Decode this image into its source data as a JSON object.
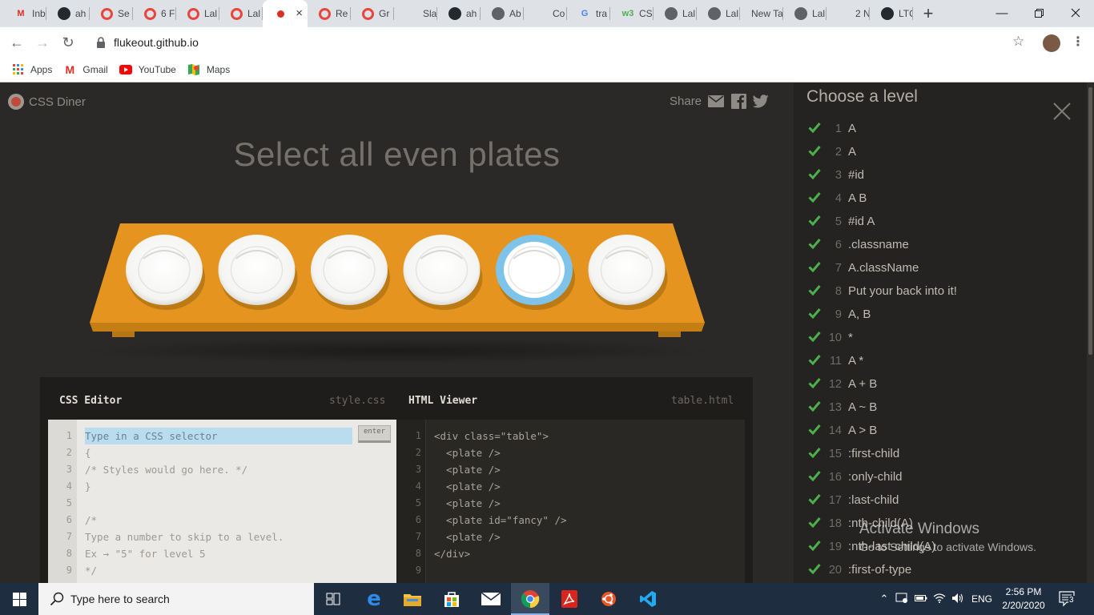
{
  "browser": {
    "tabs": [
      {
        "label": "Inb",
        "icon": "gmail-icon",
        "color": "#d93025",
        "glyph": "M"
      },
      {
        "label": "ah",
        "icon": "github-icon",
        "color": "#24292e",
        "glyph": ""
      },
      {
        "label": "Se",
        "icon": "shield-icon",
        "color": "#e8453c",
        "glyph": ""
      },
      {
        "label": "6 F",
        "icon": "shield-icon",
        "color": "#e8453c",
        "glyph": ""
      },
      {
        "label": "Lal",
        "icon": "ring-icon",
        "color": "#e8453c",
        "glyph": ""
      },
      {
        "label": "Lal",
        "icon": "ring-icon",
        "color": "#e8453c",
        "glyph": ""
      },
      {
        "label": "",
        "icon": "css-diner-icon",
        "color": "#d93025",
        "glyph": "",
        "active": true
      },
      {
        "label": "Re",
        "icon": "ring-icon",
        "color": "#e8453c",
        "glyph": ""
      },
      {
        "label": "Gr",
        "icon": "ring-icon",
        "color": "#e8453c",
        "glyph": ""
      },
      {
        "label": "Sla",
        "icon": "slack-icon",
        "color": "#4a154b",
        "glyph": ""
      },
      {
        "label": "ah",
        "icon": "github-icon",
        "color": "#24292e",
        "glyph": ""
      },
      {
        "label": "Ab",
        "icon": "globe-icon",
        "color": "#5f6368",
        "glyph": ""
      },
      {
        "label": "Co",
        "icon": "codepen-icon",
        "color": "#202124",
        "glyph": ""
      },
      {
        "label": "tra",
        "icon": "google-icon",
        "color": "#4285f4",
        "glyph": "G"
      },
      {
        "label": "CS",
        "icon": "w3-icon",
        "color": "#4caf50",
        "glyph": "w3"
      },
      {
        "label": "Lal",
        "icon": "globe-icon",
        "color": "#5f6368",
        "glyph": ""
      },
      {
        "label": "Lal",
        "icon": "globe-icon",
        "color": "#5f6368",
        "glyph": ""
      },
      {
        "label": "New Ta",
        "icon": "",
        "color": "",
        "glyph": ""
      },
      {
        "label": "Lal",
        "icon": "globe-icon",
        "color": "#5f6368",
        "glyph": ""
      },
      {
        "label": "2 N",
        "icon": "rocket-icon",
        "color": "#f5a623",
        "glyph": ""
      },
      {
        "label": "LTC",
        "icon": "github-icon",
        "color": "#24292e",
        "glyph": ""
      }
    ],
    "new_tab_label": "+",
    "url": "flukeout.github.io",
    "bookmarks": [
      {
        "label": "Apps",
        "icon": "apps-icon"
      },
      {
        "label": "Gmail",
        "icon": "gmail-icon"
      },
      {
        "label": "YouTube",
        "icon": "youtube-icon"
      },
      {
        "label": "Maps",
        "icon": "maps-icon"
      }
    ]
  },
  "page": {
    "logo": "CSS Diner",
    "share_label": "Share",
    "title": "Select all even plates",
    "plates": [
      {
        "id": "plate-1",
        "fancy": false
      },
      {
        "id": "plate-2",
        "fancy": false
      },
      {
        "id": "plate-3",
        "fancy": false
      },
      {
        "id": "plate-4",
        "fancy": false
      },
      {
        "id": "plate-5",
        "fancy": true
      },
      {
        "id": "plate-6",
        "fancy": false
      }
    ],
    "css_editor": {
      "title": "CSS Editor",
      "file": "style.css",
      "placeholder": "Type in a CSS selector",
      "enter_label": "enter",
      "line_numbers": [
        "1",
        "2",
        "3",
        "4",
        "5",
        "6",
        "7",
        "8",
        "9"
      ],
      "lines": [
        "{",
        "/* Styles would go here. */",
        "}",
        "",
        "/*",
        "Type a number to skip to a level.",
        "Ex → \"5\" for level 5",
        "*/"
      ]
    },
    "html_viewer": {
      "title": "HTML Viewer",
      "file": "table.html",
      "line_numbers": [
        "1",
        "2",
        "3",
        "4",
        "5",
        "6",
        "7",
        "8",
        "9"
      ],
      "lines": [
        "<div class=\"table\">",
        "  <plate />",
        "  <plate />",
        "  <plate />",
        "  <plate />",
        "  <plate id=\"fancy\" />",
        "  <plate />",
        "</div>",
        ""
      ]
    }
  },
  "sidebar": {
    "title": "Choose a level",
    "levels": [
      {
        "num": "1",
        "name": "A"
      },
      {
        "num": "2",
        "name": "A"
      },
      {
        "num": "3",
        "name": "#id"
      },
      {
        "num": "4",
        "name": "A  B"
      },
      {
        "num": "5",
        "name": "#id  A"
      },
      {
        "num": "6",
        "name": ".classname"
      },
      {
        "num": "7",
        "name": "A.className"
      },
      {
        "num": "8",
        "name": "Put your back into it!"
      },
      {
        "num": "9",
        "name": "A, B"
      },
      {
        "num": "10",
        "name": "*"
      },
      {
        "num": "11",
        "name": "A  *"
      },
      {
        "num": "12",
        "name": "A + B"
      },
      {
        "num": "13",
        "name": "A ~ B"
      },
      {
        "num": "14",
        "name": "A > B"
      },
      {
        "num": "15",
        "name": ":first-child"
      },
      {
        "num": "16",
        "name": ":only-child"
      },
      {
        "num": "17",
        "name": ":last-child"
      },
      {
        "num": "18",
        "name": ":nth-child(A)"
      },
      {
        "num": "19",
        "name": ":nth-last-child(A)"
      },
      {
        "num": "20",
        "name": ":first-of-type"
      }
    ],
    "check_color": "#4cb04c"
  },
  "watermark": {
    "line1": "Activate Windows",
    "line2": "Go to Settings to activate Windows."
  },
  "taskbar": {
    "search_placeholder": "Type here to search",
    "language": "ENG",
    "time": "2:56 PM",
    "date": "2/20/2020",
    "notification_count": "3"
  }
}
